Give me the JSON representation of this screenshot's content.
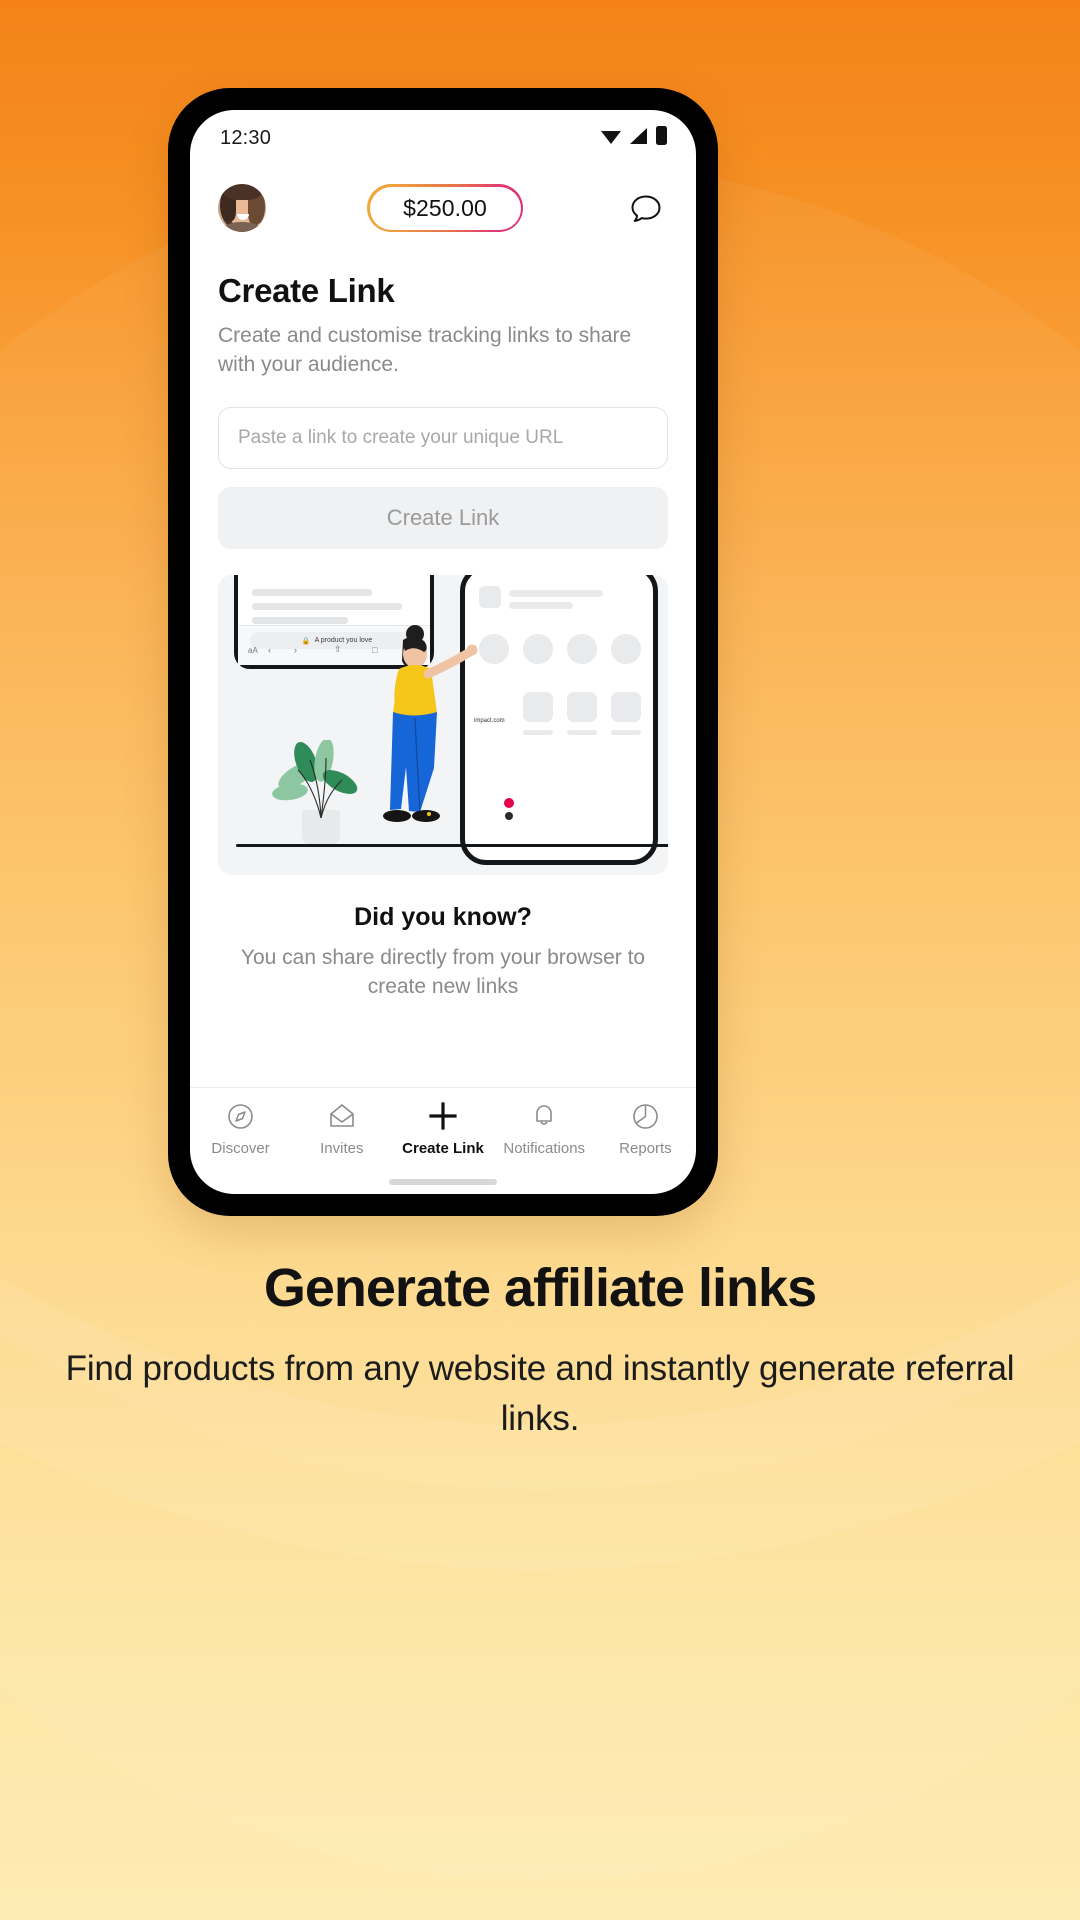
{
  "background": {
    "gradient_top": "#f47b0a",
    "gradient_bottom": "#fdecb4"
  },
  "phone": {
    "status_bar": {
      "time": "12:30",
      "icons": [
        "wifi-icon",
        "cellular-signal-icon",
        "battery-icon"
      ]
    },
    "header": {
      "avatar_label": "profile-avatar",
      "balance": "$250.00",
      "balance_border_from": "#f2a93c",
      "balance_border_to": "#d92e7b",
      "chat_icon": "chat-bubble-icon"
    },
    "main": {
      "title": "Create Link",
      "subtitle": "Create and customise tracking links to share with your audience.",
      "input_placeholder": "Paste a link to create your unique URL",
      "input_value": "",
      "create_button": "Create Link",
      "illustration": {
        "browser_url_text": "A product you love",
        "app_name": "impact.com",
        "back_glyph": "‹",
        "forward_glyph": "›",
        "share_glyph": "⇧",
        "book_glyph": "□",
        "reload_glyph": "↻",
        "aa_glyph": "aA",
        "lock_glyph": "🔒"
      },
      "did_you_know_title": "Did you know?",
      "did_you_know_body": "You can share directly from your browser to create new links"
    },
    "tabbar": [
      {
        "label": "Discover",
        "icon": "compass-icon",
        "active": false
      },
      {
        "label": "Invites",
        "icon": "envelope-icon",
        "active": false
      },
      {
        "label": "Create Link",
        "icon": "plus-icon",
        "active": true
      },
      {
        "label": "Notifications",
        "icon": "bell-icon",
        "active": false
      },
      {
        "label": "Reports",
        "icon": "pie-chart-icon",
        "active": false
      }
    ]
  },
  "caption": {
    "headline": "Generate affiliate links",
    "body": "Find products from any website and instantly generate referral links."
  }
}
